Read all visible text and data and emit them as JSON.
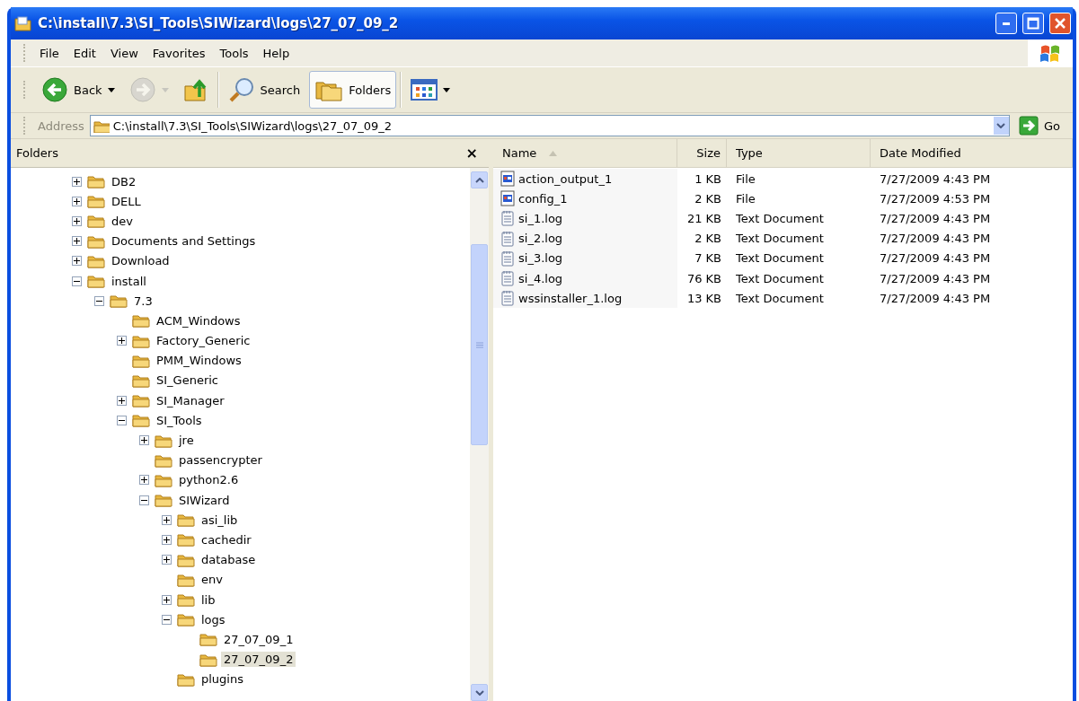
{
  "window": {
    "title": "C:\\install\\7.3\\SI_Tools\\SIWizard\\logs\\27_07_09_2"
  },
  "menu": [
    {
      "label": "File"
    },
    {
      "label": "Edit"
    },
    {
      "label": "View"
    },
    {
      "label": "Favorites"
    },
    {
      "label": "Tools"
    },
    {
      "label": "Help"
    }
  ],
  "toolbar": {
    "groups": [
      [
        {
          "kind": "back",
          "label": "Back",
          "dropdown": true,
          "disabled": false,
          "pressed": false
        },
        {
          "kind": "forward",
          "dropdown": true,
          "disabled": true,
          "pressed": false
        },
        {
          "kind": "up",
          "dropdown": false,
          "disabled": false,
          "pressed": false
        }
      ],
      [
        {
          "kind": "search",
          "label": "Search",
          "dropdown": false,
          "disabled": false,
          "pressed": false
        },
        {
          "kind": "folders",
          "label": "Folders",
          "dropdown": false,
          "disabled": false,
          "pressed": true
        }
      ],
      [
        {
          "kind": "views",
          "dropdown": true,
          "disabled": false,
          "pressed": false
        }
      ]
    ]
  },
  "address_bar": {
    "label": "Address",
    "value": "C:\\install\\7.3\\SI_Tools\\SIWizard\\logs\\27_07_09_2",
    "go_label": "Go"
  },
  "folders_pane": {
    "title": "Folders",
    "close": "×",
    "tree": [
      {
        "label": "DB2",
        "expandable": true,
        "expanded": false,
        "selected": false
      },
      {
        "label": "DELL",
        "expandable": true,
        "expanded": false,
        "selected": false
      },
      {
        "label": "dev",
        "expandable": true,
        "expanded": false,
        "selected": false
      },
      {
        "label": "Documents and Settings",
        "expandable": true,
        "expanded": false,
        "selected": false
      },
      {
        "label": "Download",
        "expandable": true,
        "expanded": false,
        "selected": false
      },
      {
        "label": "install",
        "expandable": true,
        "expanded": true,
        "selected": false,
        "children": [
          {
            "label": "7.3",
            "expandable": true,
            "expanded": true,
            "selected": false,
            "children": [
              {
                "label": "ACM_Windows",
                "expandable": false,
                "selected": false
              },
              {
                "label": "Factory_Generic",
                "expandable": true,
                "expanded": false,
                "selected": false
              },
              {
                "label": "PMM_Windows",
                "expandable": false,
                "selected": false
              },
              {
                "label": "SI_Generic",
                "expandable": false,
                "selected": false
              },
              {
                "label": "SI_Manager",
                "expandable": true,
                "expanded": false,
                "selected": false
              },
              {
                "label": "SI_Tools",
                "expandable": true,
                "expanded": true,
                "selected": false,
                "children": [
                  {
                    "label": "jre",
                    "expandable": true,
                    "expanded": false,
                    "selected": false
                  },
                  {
                    "label": "passencrypter",
                    "expandable": false,
                    "selected": false
                  },
                  {
                    "label": "python2.6",
                    "expandable": true,
                    "expanded": false,
                    "selected": false
                  },
                  {
                    "label": "SIWizard",
                    "expandable": true,
                    "expanded": true,
                    "selected": false,
                    "children": [
                      {
                        "label": "asi_lib",
                        "expandable": true,
                        "expanded": false,
                        "selected": false
                      },
                      {
                        "label": "cachedir",
                        "expandable": true,
                        "expanded": false,
                        "selected": false
                      },
                      {
                        "label": "database",
                        "expandable": true,
                        "expanded": false,
                        "selected": false
                      },
                      {
                        "label": "env",
                        "expandable": false,
                        "selected": false
                      },
                      {
                        "label": "lib",
                        "expandable": true,
                        "expanded": false,
                        "selected": false
                      },
                      {
                        "label": "logs",
                        "expandable": true,
                        "expanded": true,
                        "selected": false,
                        "children": [
                          {
                            "label": "27_07_09_1",
                            "expandable": false,
                            "selected": false
                          },
                          {
                            "label": "27_07_09_2",
                            "expandable": false,
                            "selected": true
                          }
                        ]
                      },
                      {
                        "label": "plugins",
                        "expandable": false,
                        "selected": false
                      }
                    ]
                  }
                ]
              }
            ]
          }
        ]
      }
    ]
  },
  "file_list": {
    "columns": [
      {
        "label": "Name",
        "sorted": true
      },
      {
        "label": "Size",
        "sorted": false
      },
      {
        "label": "Type",
        "sorted": false
      },
      {
        "label": "Date Modified",
        "sorted": false
      }
    ],
    "rows": [
      {
        "kind": "app",
        "name": "action_output_1",
        "size": "1 KB",
        "type": "File",
        "date": "7/27/2009 4:43 PM"
      },
      {
        "kind": "app",
        "name": "config_1",
        "size": "2 KB",
        "type": "File",
        "date": "7/27/2009 4:53 PM"
      },
      {
        "kind": "text",
        "name": "si_1.log",
        "size": "21 KB",
        "type": "Text Document",
        "date": "7/27/2009 4:43 PM"
      },
      {
        "kind": "text",
        "name": "si_2.log",
        "size": "2 KB",
        "type": "Text Document",
        "date": "7/27/2009 4:43 PM"
      },
      {
        "kind": "text",
        "name": "si_3.log",
        "size": "7 KB",
        "type": "Text Document",
        "date": "7/27/2009 4:43 PM"
      },
      {
        "kind": "text",
        "name": "si_4.log",
        "size": "76 KB",
        "type": "Text Document",
        "date": "7/27/2009 4:43 PM"
      },
      {
        "kind": "text",
        "name": "wssinstaller_1.log",
        "size": "13 KB",
        "type": "Text Document",
        "date": "7/27/2009 4:43 PM"
      }
    ]
  }
}
